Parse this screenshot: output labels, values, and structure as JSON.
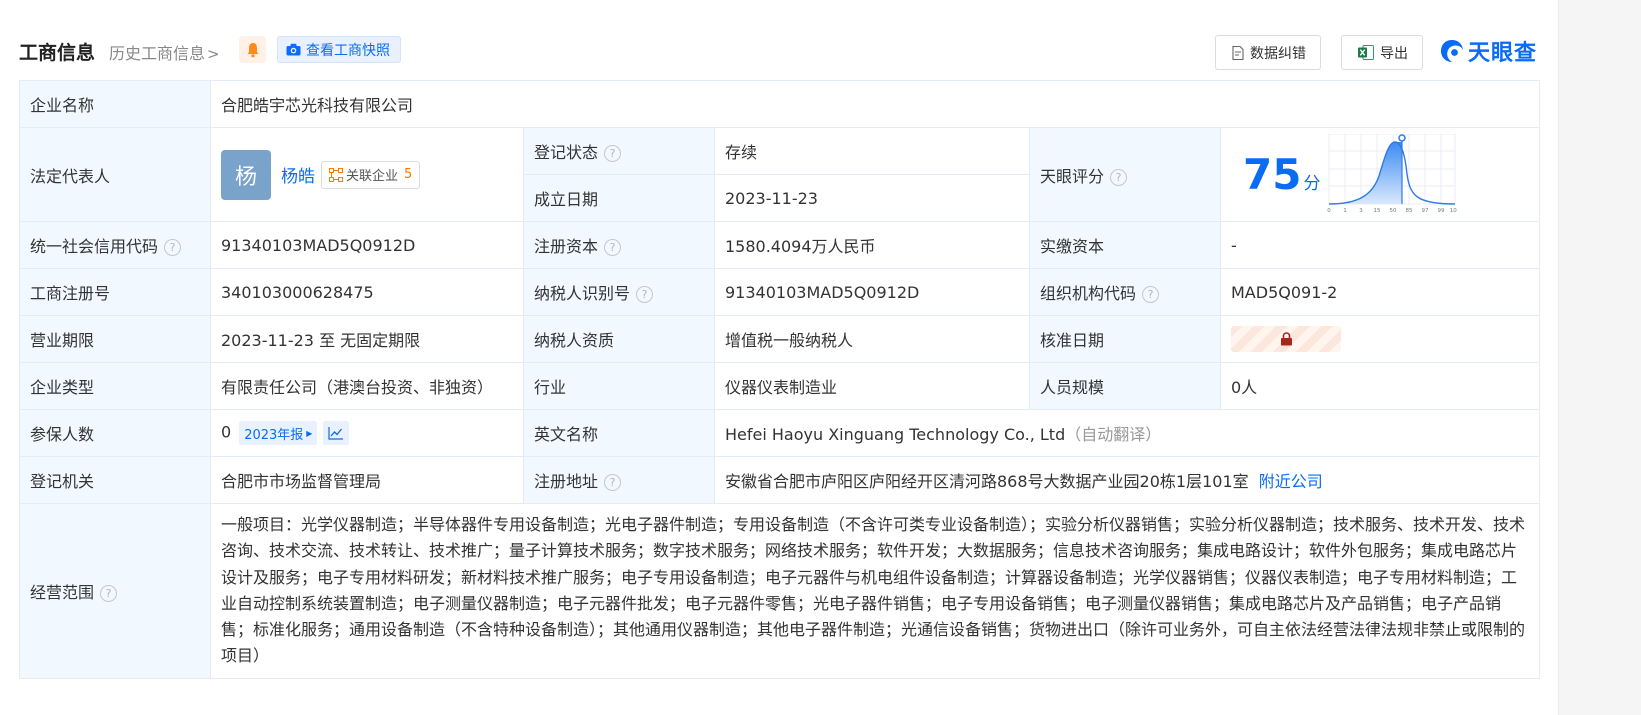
{
  "header": {
    "title": "工商信息",
    "history_link": "历史工商信息",
    "history_chevron": ">",
    "snapshot_button": "查看工商快照",
    "correction_button": "数据纠错",
    "export_button": "导出",
    "brand": "天眼查"
  },
  "labels": {
    "company_name": "企业名称",
    "legal_rep": "法定代表人",
    "reg_status": "登记状态",
    "founded_date": "成立日期",
    "tianyan_score": "天眼评分",
    "credit_code": "统一社会信用代码",
    "reg_capital": "注册资本",
    "paid_capital": "实缴资本",
    "biz_reg_no": "工商注册号",
    "taxpayer_id": "纳税人识别号",
    "org_code": "组织机构代码",
    "biz_term": "营业期限",
    "taxpayer_qual": "纳税人资质",
    "approval_date": "核准日期",
    "company_type": "企业类型",
    "industry": "行业",
    "staff_size": "人员规模",
    "insured_count": "参保人数",
    "english_name": "英文名称",
    "reg_authority": "登记机关",
    "reg_address": "注册地址",
    "biz_scope": "经营范围"
  },
  "values": {
    "company_name": "合肥皓宇芯光科技有限公司",
    "legal_rep_avatar": "杨",
    "legal_rep_name": "杨皓",
    "related_label": "关联企业",
    "related_count": "5",
    "reg_status": "存续",
    "founded_date": "2023-11-23",
    "score": "75",
    "score_unit": "分",
    "score_axis": [
      "0",
      "1",
      "3",
      "15",
      "50",
      "85",
      "97",
      "99",
      "100"
    ],
    "credit_code": "91340103MAD5Q0912D",
    "reg_capital": "1580.4094万人民币",
    "paid_capital": "-",
    "biz_reg_no": "340103000628475",
    "taxpayer_id": "91340103MAD5Q0912D",
    "org_code": "MAD5Q091-2",
    "biz_term": "2023-11-23 至 无固定期限",
    "taxpayer_qual": "增值税一般纳税人",
    "company_type": "有限责任公司（港澳台投资、非独资）",
    "industry": "仪器仪表制造业",
    "staff_size": "0人",
    "insured_count": "0",
    "report_year": "2023年报",
    "english_name": "Hefei Haoyu Xinguang Technology Co., Ltd",
    "english_auto": "（自动翻译）",
    "reg_authority": "合肥市市场监督管理局",
    "reg_address": "安徽省合肥市庐阳区庐阳经开区清河路868号大数据产业园20栋1层101室",
    "nearby_link": "附近公司",
    "biz_scope": "一般项目：光学仪器制造；半导体器件专用设备制造；光电子器件制造；专用设备制造（不含许可类专业设备制造）；实验分析仪器销售；实验分析仪器制造；技术服务、技术开发、技术咨询、技术交流、技术转让、技术推广；量子计算技术服务；数字技术服务；网络技术服务；软件开发；大数据服务；信息技术咨询服务；集成电路设计；软件外包服务；集成电路芯片设计及服务；电子专用材料研发；新材料技术推广服务；电子专用设备制造；电子元器件与机电组件设备制造；计算器设备制造；光学仪器销售；仪器仪表制造；电子专用材料制造；工业自动控制系统装置制造；电子测量仪器制造；电子元器件批发；电子元器件零售；光电子器件销售；电子专用设备销售；电子测量仪器销售；集成电路芯片及产品销售；电子产品销售；标准化服务；通用设备制造（不含特种设备制造）；其他通用仪器制造；其他电子器件制造；光通信设备销售；货物进出口（除许可业务外，可自主依法经营法律法规非禁止或限制的项目）"
  },
  "help_mark": "?",
  "colors": {
    "accent": "#0a6cf5",
    "status_green": "#22a045",
    "label_bg": "#f2f8ff",
    "border": "#e4ecf5",
    "orange": "#ff7a00"
  }
}
